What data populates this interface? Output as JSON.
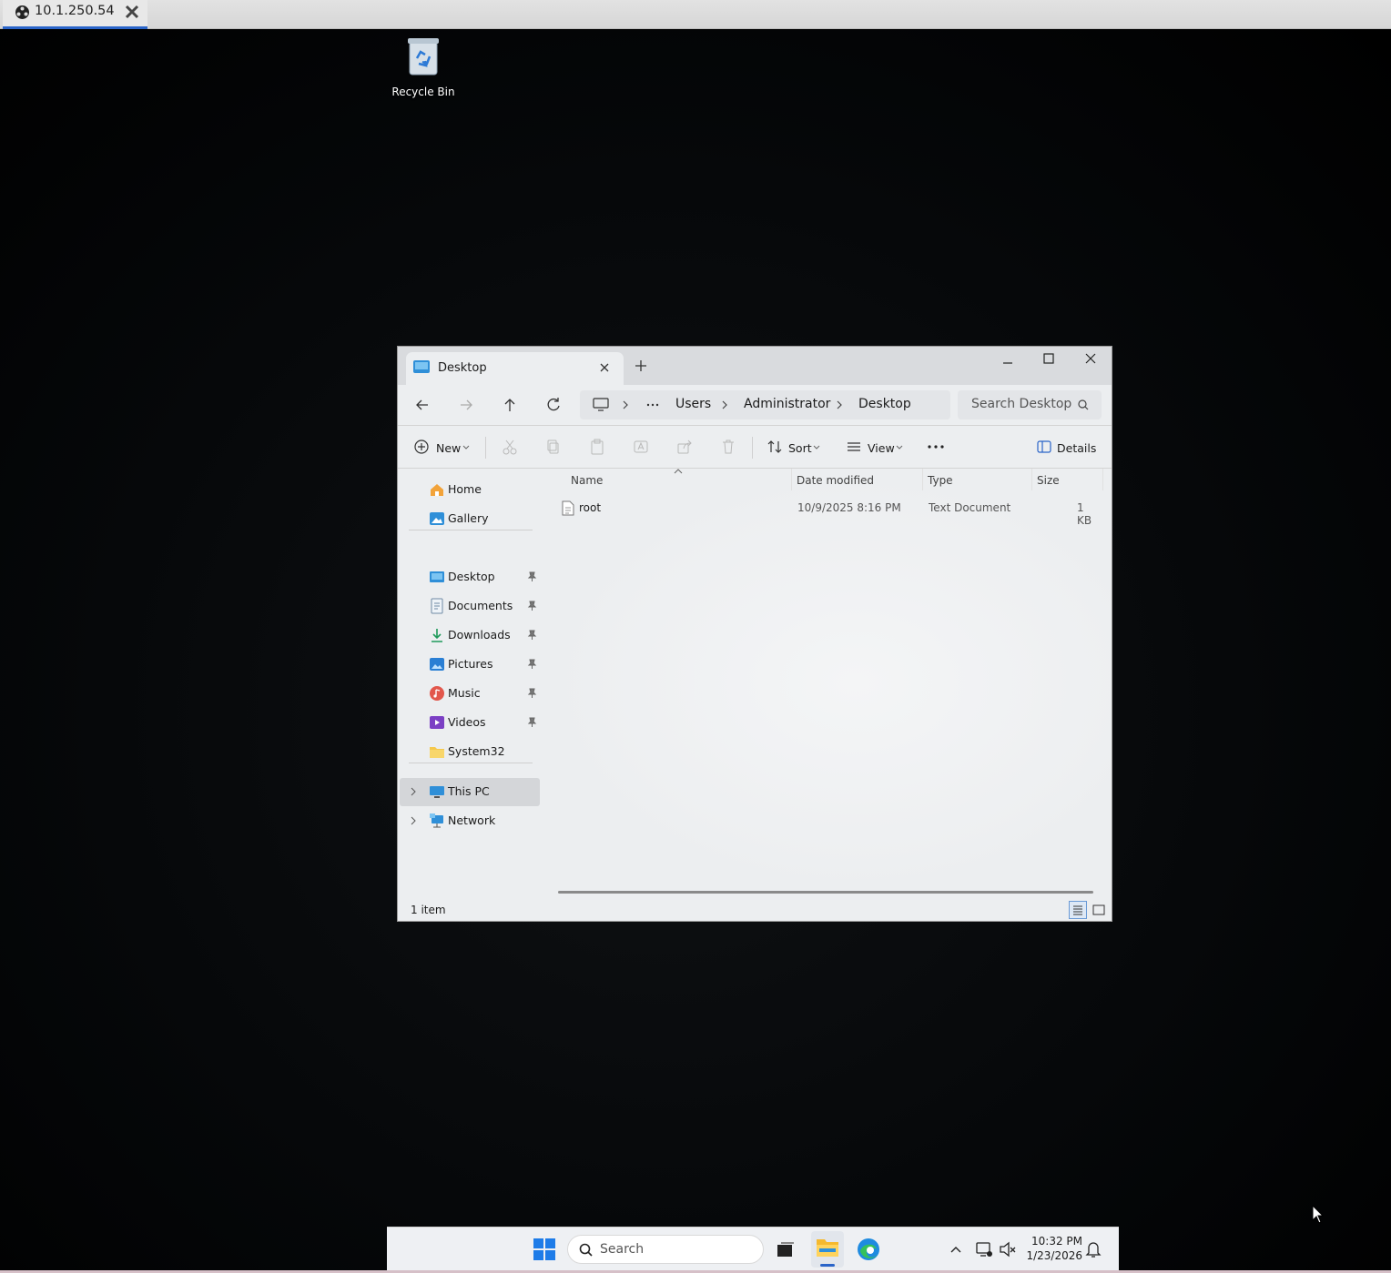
{
  "remote": {
    "tab_title": "10.1.250.54"
  },
  "desktop": {
    "recycle_bin": "Recycle Bin"
  },
  "explorer": {
    "tab_title": "Desktop",
    "breadcrumb": [
      "Users",
      "Administrator",
      "Desktop"
    ],
    "search_placeholder": "Search Desktop",
    "toolbar": {
      "new": "New",
      "sort": "Sort",
      "view": "View",
      "details": "Details"
    },
    "nav": {
      "home": "Home",
      "gallery": "Gallery",
      "quick": [
        "Desktop",
        "Documents",
        "Downloads",
        "Pictures",
        "Music",
        "Videos",
        "System32"
      ],
      "this_pc": "This PC",
      "network": "Network"
    },
    "columns": {
      "name": "Name",
      "date": "Date modified",
      "type": "Type",
      "size": "Size"
    },
    "files": [
      {
        "name": "root",
        "date": "10/9/2025 8:16 PM",
        "type": "Text Document",
        "size": "1 KB"
      }
    ],
    "status": "1 item"
  },
  "taskbar": {
    "search": "Search",
    "time": "10:32 PM",
    "date": "1/23/2026"
  },
  "colors": {
    "accent": "#2a64c8",
    "desktop_bg": "#000000",
    "window_bg": "#eceef0"
  }
}
